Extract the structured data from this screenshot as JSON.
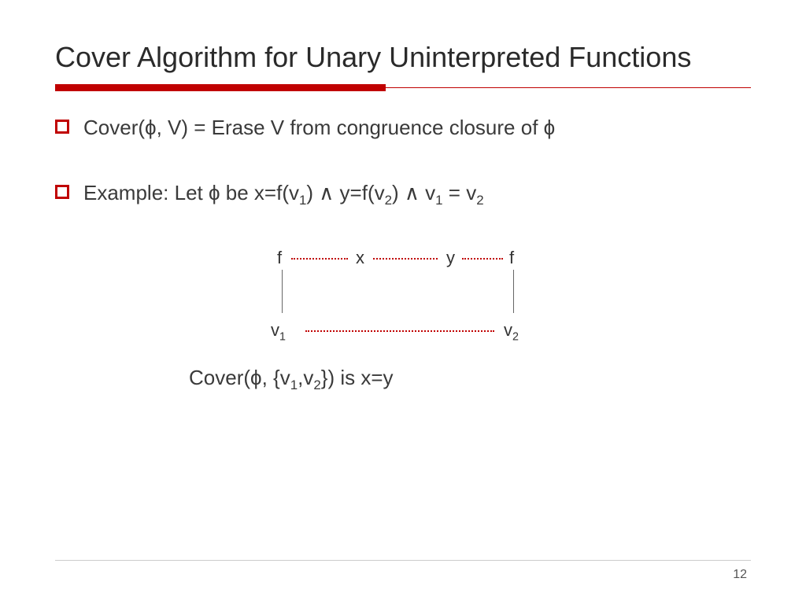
{
  "title": "Cover Algorithm for Unary Uninterpreted Functions",
  "bullets": {
    "b1_pre": "Cover(",
    "b1_phi": "ϕ",
    "b1_mid": ", V) = Erase V from congruence closure of ",
    "b1_phi2": "ϕ",
    "b2_pre": "Example: Let ",
    "b2_phi": "ϕ",
    "b2_mid1": " be x=f(v",
    "b2_s1": "1",
    "b2_mid2": ") ",
    "b2_and1": "∧",
    "b2_mid3": " y=f(v",
    "b2_s2": "2",
    "b2_mid4": ") ",
    "b2_and2": "∧",
    "b2_mid5": " v",
    "b2_s3": "1",
    "b2_mid6": " = v",
    "b2_s4": "2"
  },
  "diagram": {
    "f1": "f",
    "x": "x",
    "y": "y",
    "f2": "f",
    "v1_base": "v",
    "v1_sub": "1",
    "v2_base": "v",
    "v2_sub": "2"
  },
  "conclusion": {
    "pre": "Cover(",
    "phi": "ϕ",
    "mid1": ", {v",
    "s1": "1",
    "mid2": ",v",
    "s2": "2",
    "mid3": "}) is x=y"
  },
  "page": "12"
}
